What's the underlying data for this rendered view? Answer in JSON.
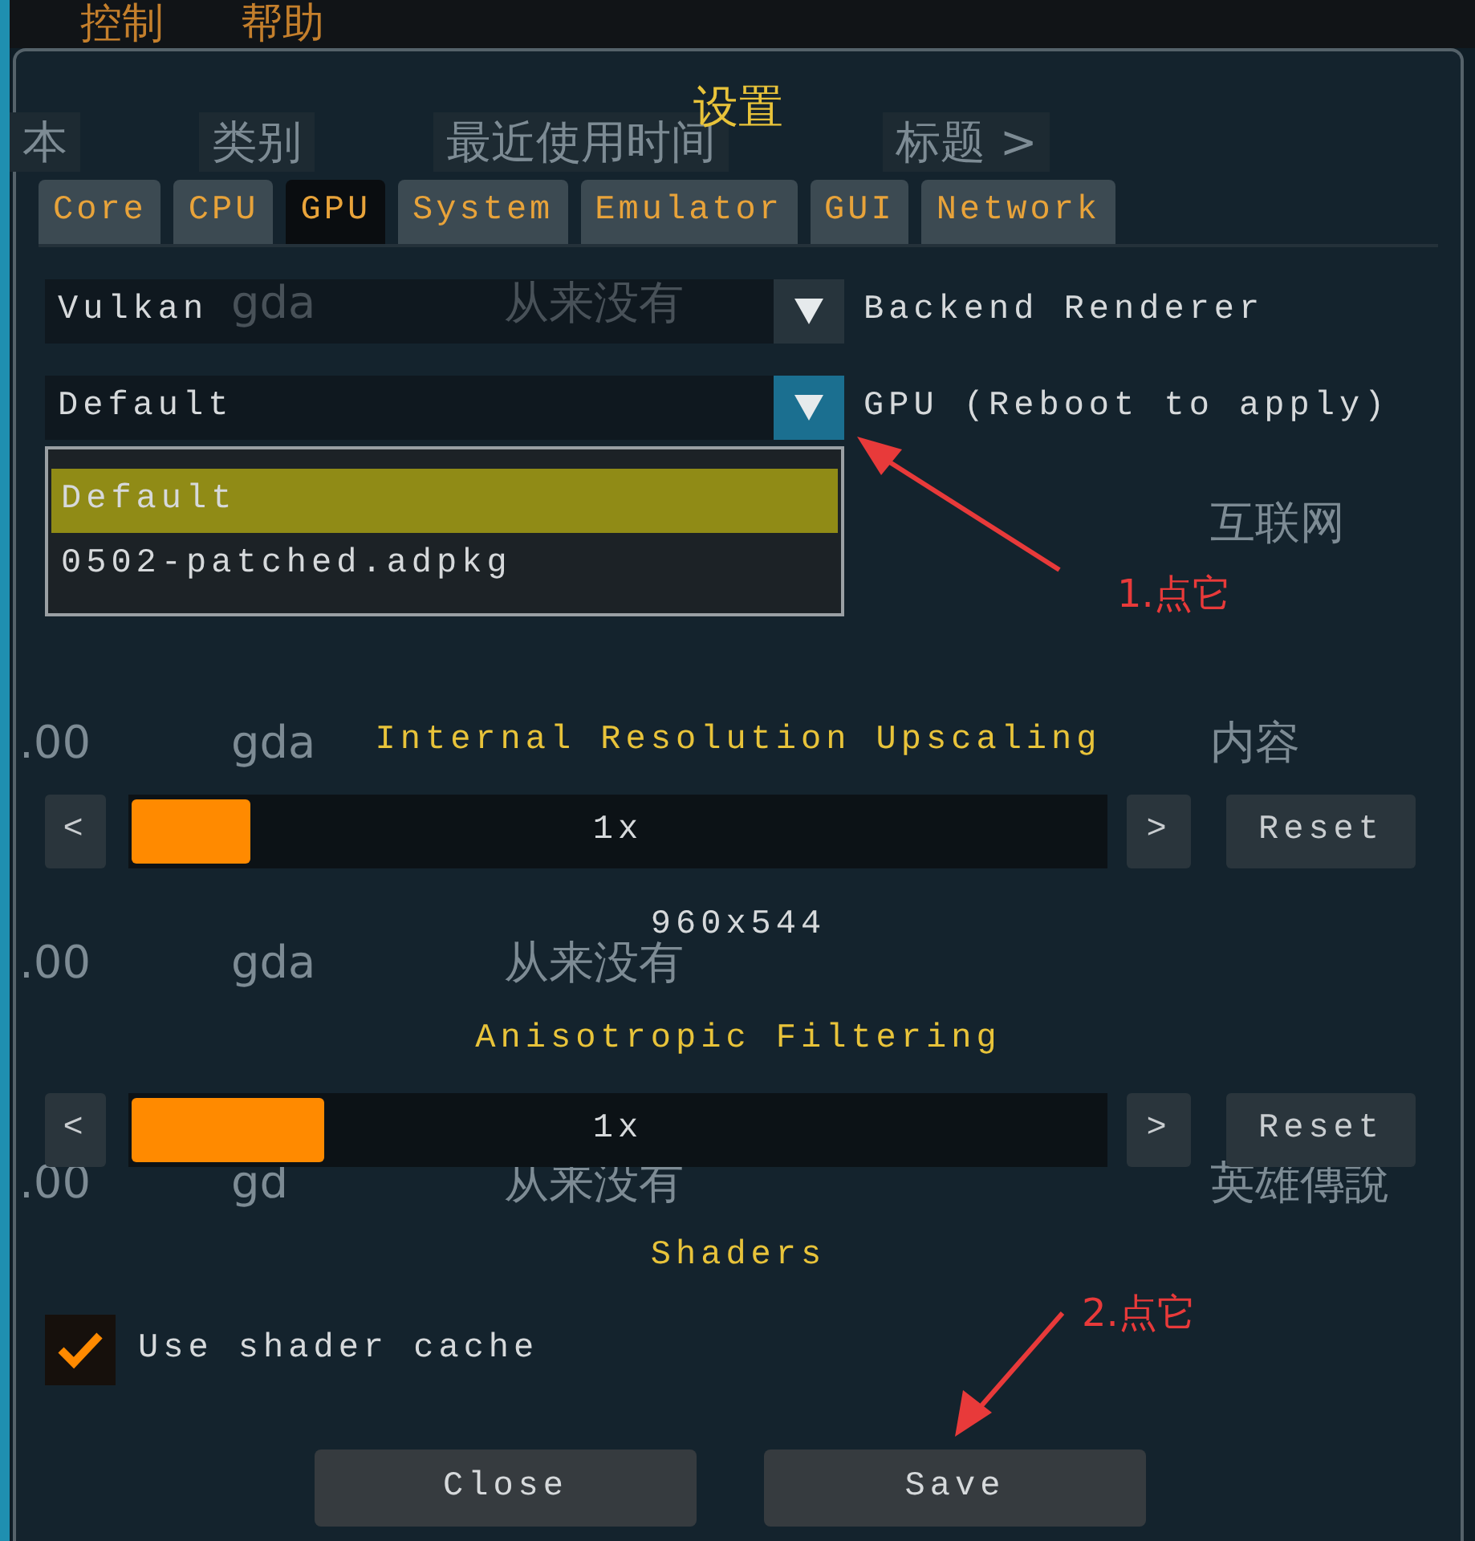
{
  "menu": [
    "控制",
    "帮助"
  ],
  "background_table": {
    "columns": [
      "本",
      "类别",
      "最近使用时间",
      "标题 >"
    ],
    "rows": [
      {
        "name": "gda",
        "last_used": "从来没有"
      },
      {
        "title": "互联网"
      },
      {
        "number": ".00",
        "name": "gda",
        "title": "内容"
      },
      {
        "number": ".00",
        "name": "gda",
        "last_used": "从来没有"
      },
      {
        "number": ".00",
        "name": "gd",
        "last_used": "从来没有",
        "title": "英雄傳說"
      }
    ]
  },
  "dialog": {
    "title": "设置",
    "tabs": [
      {
        "label": "Core",
        "selected": false
      },
      {
        "label": "CPU",
        "selected": false
      },
      {
        "label": "GPU",
        "selected": true
      },
      {
        "label": "System",
        "selected": false
      },
      {
        "label": "Emulator",
        "selected": false
      },
      {
        "label": "GUI",
        "selected": false
      },
      {
        "label": "Network",
        "selected": false
      }
    ],
    "combos": [
      {
        "value": "Vulkan",
        "label": "Backend Renderer",
        "open": false
      },
      {
        "value": "Default",
        "label": "GPU (Reboot to apply)",
        "open": true,
        "options": [
          {
            "label": "Default",
            "selected": true
          },
          {
            "label": "0502-patched.adpkg",
            "selected": false
          }
        ]
      }
    ],
    "sections": [
      {
        "title": "Internal Resolution Upscaling",
        "slider": {
          "value": "1x",
          "level": 0,
          "dec": "<",
          "inc": ">",
          "reset": "Reset"
        },
        "note": "960x544"
      },
      {
        "title": "Anisotropic Filtering",
        "slider": {
          "value": "1x",
          "level": 0,
          "dec": "<",
          "inc": ">",
          "reset": "Reset"
        }
      },
      {
        "title": "Shaders",
        "checkbox": {
          "label": "Use shader cache",
          "checked": true
        }
      }
    ],
    "buttons": [
      "Close",
      "Save"
    ]
  },
  "annotations": [
    "1.点它",
    "2.点它"
  ]
}
